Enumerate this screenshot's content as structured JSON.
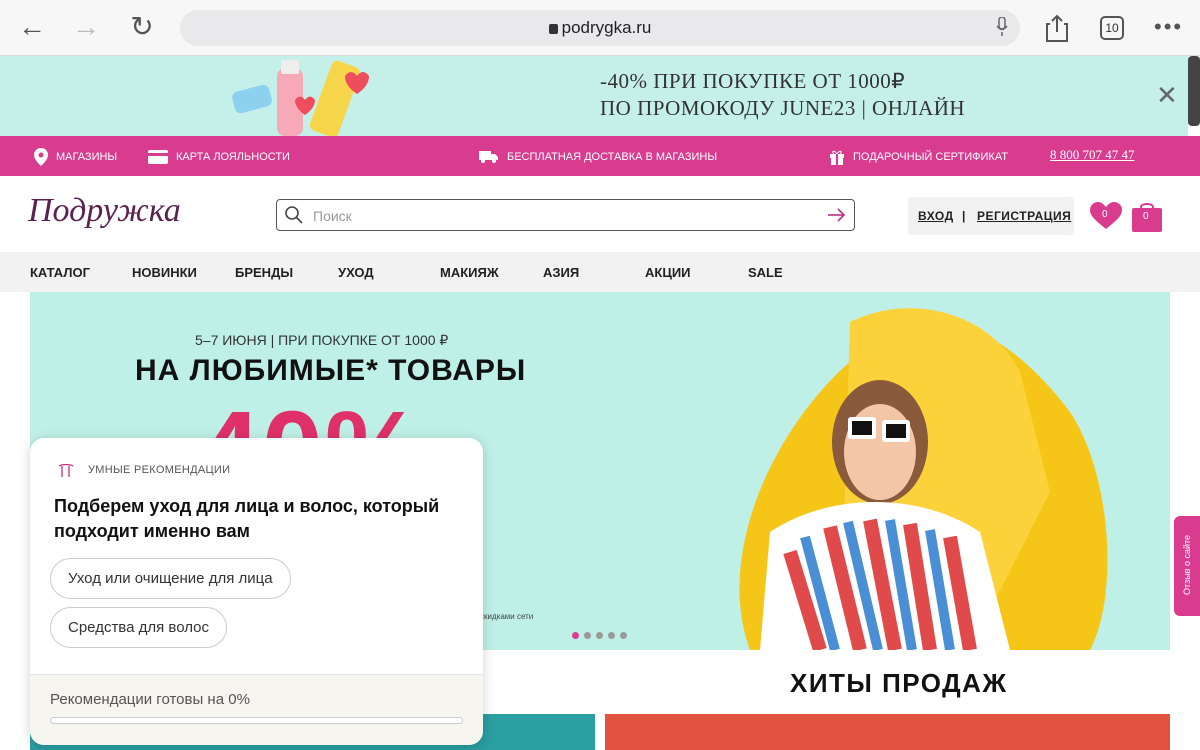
{
  "browser": {
    "url": "podrygka.ru",
    "tabs_count": "10"
  },
  "promo": {
    "line1": "-40% ПРИ ПОКУПКЕ ОТ 1000₽",
    "line2": "ПО ПРОМОКОДУ JUNE23 | ОНЛАЙН"
  },
  "topbar": {
    "stores": "МАГАЗИНЫ",
    "loyalty": "КАРТА ЛОЯЛЬНОСТИ",
    "delivery": "БЕСПЛАТНАЯ ДОСТАВКА В МАГАЗИНЫ",
    "gift": "ПОДАРОЧНЫЙ СЕРТИФИКАТ",
    "phone": "8 800 707 47 47"
  },
  "header": {
    "logo": "Подружка",
    "search_placeholder": "Поиск",
    "login": "ВХОД",
    "separator": "|",
    "register": "РЕГИСТРАЦИЯ",
    "wishlist_count": "0",
    "cart_count": "0"
  },
  "nav": [
    "КАТАЛОГ",
    "НОВИНКИ",
    "БРЕНДЫ",
    "УХОД",
    "МАКИЯЖ",
    "АЗИЯ",
    "АКЦИИ",
    "SALE"
  ],
  "hero": {
    "dates": "5–7 ИЮНЯ | ПРИ ПОКУПКЕ ОТ 1000 ₽",
    "headline": "НА ЛЮБИМЫЕ* ТОВАРЫ",
    "percent": "-40%",
    "note": "скидками сети"
  },
  "popup": {
    "header": "УМНЫЕ РЕКОМЕНДАЦИИ",
    "question": "Подберем уход для лица и волос, который подходит именно вам",
    "option1": "Уход или очищение для лица",
    "option2": "Средства для волос",
    "progress_label": "Рекомендации готовы на 0%",
    "progress": 0
  },
  "feedback": "Отзыв о сайте",
  "hits_title": "ХИТЫ ПРОДАЖ",
  "colors": {
    "brand_pink": "#d93c8f",
    "promo_bg": "#c5f0ea",
    "hero_bg": "#bff0e7",
    "percent_red": "#e0306a"
  }
}
